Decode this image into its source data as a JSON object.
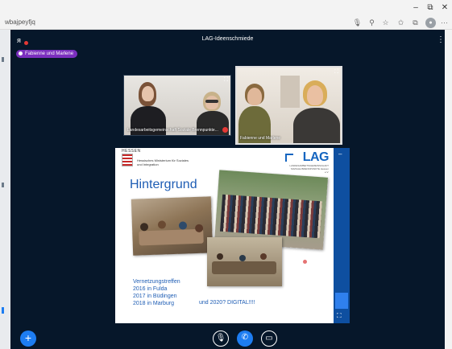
{
  "browser": {
    "url": "wbajpeyfjq",
    "window_controls": {
      "minimize": "–",
      "restore": "⧉",
      "close": "✕"
    },
    "toolbar_icons": [
      "mic-icon",
      "zoom-icon",
      "star-icon",
      "favorites-icon",
      "collections-icon",
      "profile-icon",
      "more-icon"
    ],
    "more_label": "···"
  },
  "meeting": {
    "title": "LAG-Ideenschmiede",
    "speaker_pill": "Fabienne und Marlene",
    "options_label": "⋮"
  },
  "videos": [
    {
      "name": "Landesarbeitsgemeinschaft Soziale Brennpunkte...",
      "expand": "⛶"
    },
    {
      "name": "Fabienne und Marlene",
      "expand": "⛶"
    }
  ],
  "slide": {
    "state_label": "HESSEN",
    "ministry": "Hessisches Ministerium für Soziales und Integration",
    "logo": "LAG",
    "logo_sub": "LANDESARBEITSGEMEINSCHAFT SOZIALE BRENNPUNKTE Hessen e.V.",
    "heading": "Hintergrund",
    "lines": [
      "Vernetzungstreffen",
      "2016 in Fulda",
      "2017 in Büdingen",
      "2018 in Marburg"
    ],
    "extra": "und 2020? DIGITAL!!!!",
    "side_toggle": "–",
    "fullscreen": "⛶"
  },
  "controls": {
    "plus": "+",
    "mic": "🎙",
    "phone": "✆",
    "camera": "▭"
  },
  "colors": {
    "app_bg": "#06172a",
    "accent": "#1d7df2",
    "pill": "#7b2fbe",
    "slide_text": "#1e5db4"
  }
}
